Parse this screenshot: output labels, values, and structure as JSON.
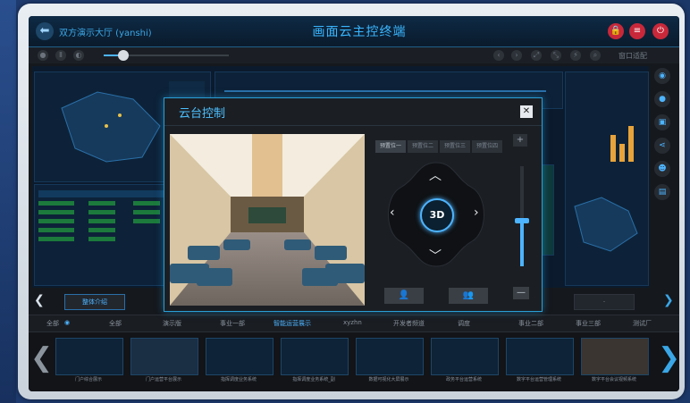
{
  "header": {
    "project_name": "双方演示大厅 (yanshi)",
    "title": "画面云主控终端",
    "buttons": [
      "lock-icon",
      "menu-icon",
      "power-icon"
    ]
  },
  "toolbar": {
    "fit_label": "窗口适配"
  },
  "dialog": {
    "title": "云台控制",
    "close": "✕",
    "camera_tabs": [
      "预置位一",
      "预置位二",
      "预置位三",
      "预置位四"
    ],
    "center_label": "3D",
    "add": "+",
    "minus": "—",
    "icons": [
      "user-icon",
      "group-icon"
    ]
  },
  "layouts": {
    "items": [
      "整体介绍",
      "",
      "",
      "",
      "",
      "",
      "",
      "·"
    ]
  },
  "categories": {
    "all_label": "全部",
    "items": [
      "全部",
      "演示版",
      "事业一部",
      "智能运营展示",
      "xyzhn",
      "开发者频道",
      "调度",
      "事业二部",
      "事业三部",
      "测试厂"
    ]
  },
  "thumbnails": [
    {
      "caption": "门户综合展示"
    },
    {
      "caption": "门户运营平台展示"
    },
    {
      "caption": "指挥调度业务系统"
    },
    {
      "caption": "指挥调度业务系统_副"
    },
    {
      "caption": "数据可视化大屏展示"
    },
    {
      "caption": "政务平台运营系统"
    },
    {
      "caption": "数字平台运营管理系统"
    },
    {
      "caption": "数字平台会议视频系统"
    }
  ],
  "colors": {
    "accent": "#4db4ff",
    "modal_border": "#2a9fd6",
    "danger": "#c8283a"
  }
}
